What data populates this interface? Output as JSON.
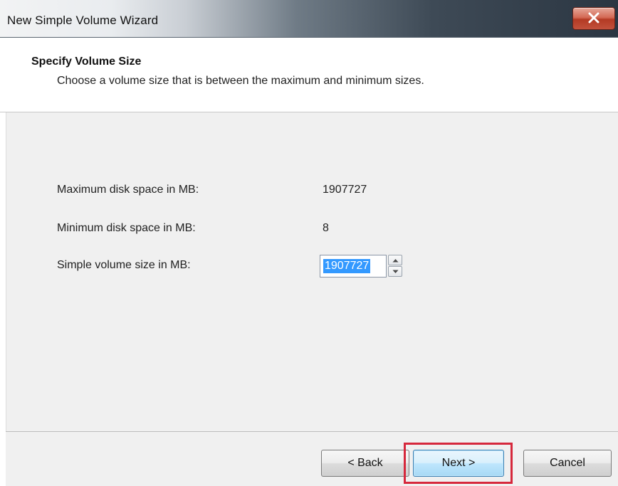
{
  "window": {
    "title": "New Simple Volume Wizard",
    "close_icon": "close-icon"
  },
  "header": {
    "title": "Specify Volume Size",
    "subtitle": "Choose a volume size that is between the maximum and minimum sizes."
  },
  "form": {
    "max_label": "Maximum disk space in MB:",
    "max_value": "1907727",
    "min_label": "Minimum disk space in MB:",
    "min_value": "8",
    "size_label": "Simple volume size in MB:",
    "size_value": "1907727"
  },
  "buttons": {
    "back": "< Back",
    "next": "Next >",
    "cancel": "Cancel"
  },
  "colors": {
    "selection": "#3399ff",
    "highlight_box": "#d6283c",
    "panel": "#f0f0f0"
  }
}
